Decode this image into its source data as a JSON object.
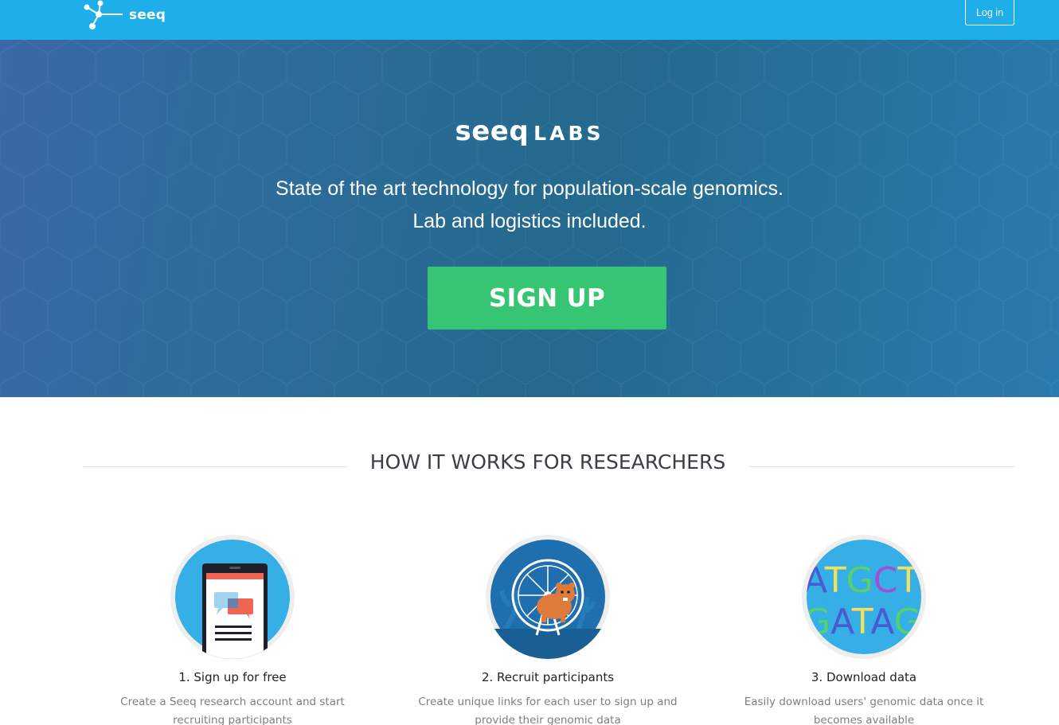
{
  "navbar": {
    "brand": "seeq",
    "login_label": "Log in"
  },
  "hero": {
    "logo_seeq": "seeq",
    "logo_labs": "LABS",
    "tagline_line1": "State of the art technology for population-scale genomics.",
    "tagline_line2": "Lab and logistics included.",
    "signup_label": "SIGN UP"
  },
  "how_it_works": {
    "title": "HOW IT WORKS FOR RESEARCHERS",
    "steps": [
      {
        "title": "1. Sign up for free",
        "description": "Create a Seeq research account and start recruiting participants",
        "icon": "phone-chat-icon"
      },
      {
        "title": "2. Recruit participants",
        "description": "Create unique links for each user to sign up and provide their genomic data",
        "icon": "hamster-wheel-icon"
      },
      {
        "title": "3. Download data",
        "description": "Easily download users' genomic data once it becomes available",
        "icon": "dna-letters-icon",
        "letters_row1": "ATGCT",
        "letters_row2": "GATAG"
      }
    ]
  },
  "colors": {
    "navbar": "#1eaeea",
    "signup": "#36c572",
    "heading": "#3b3f44"
  }
}
